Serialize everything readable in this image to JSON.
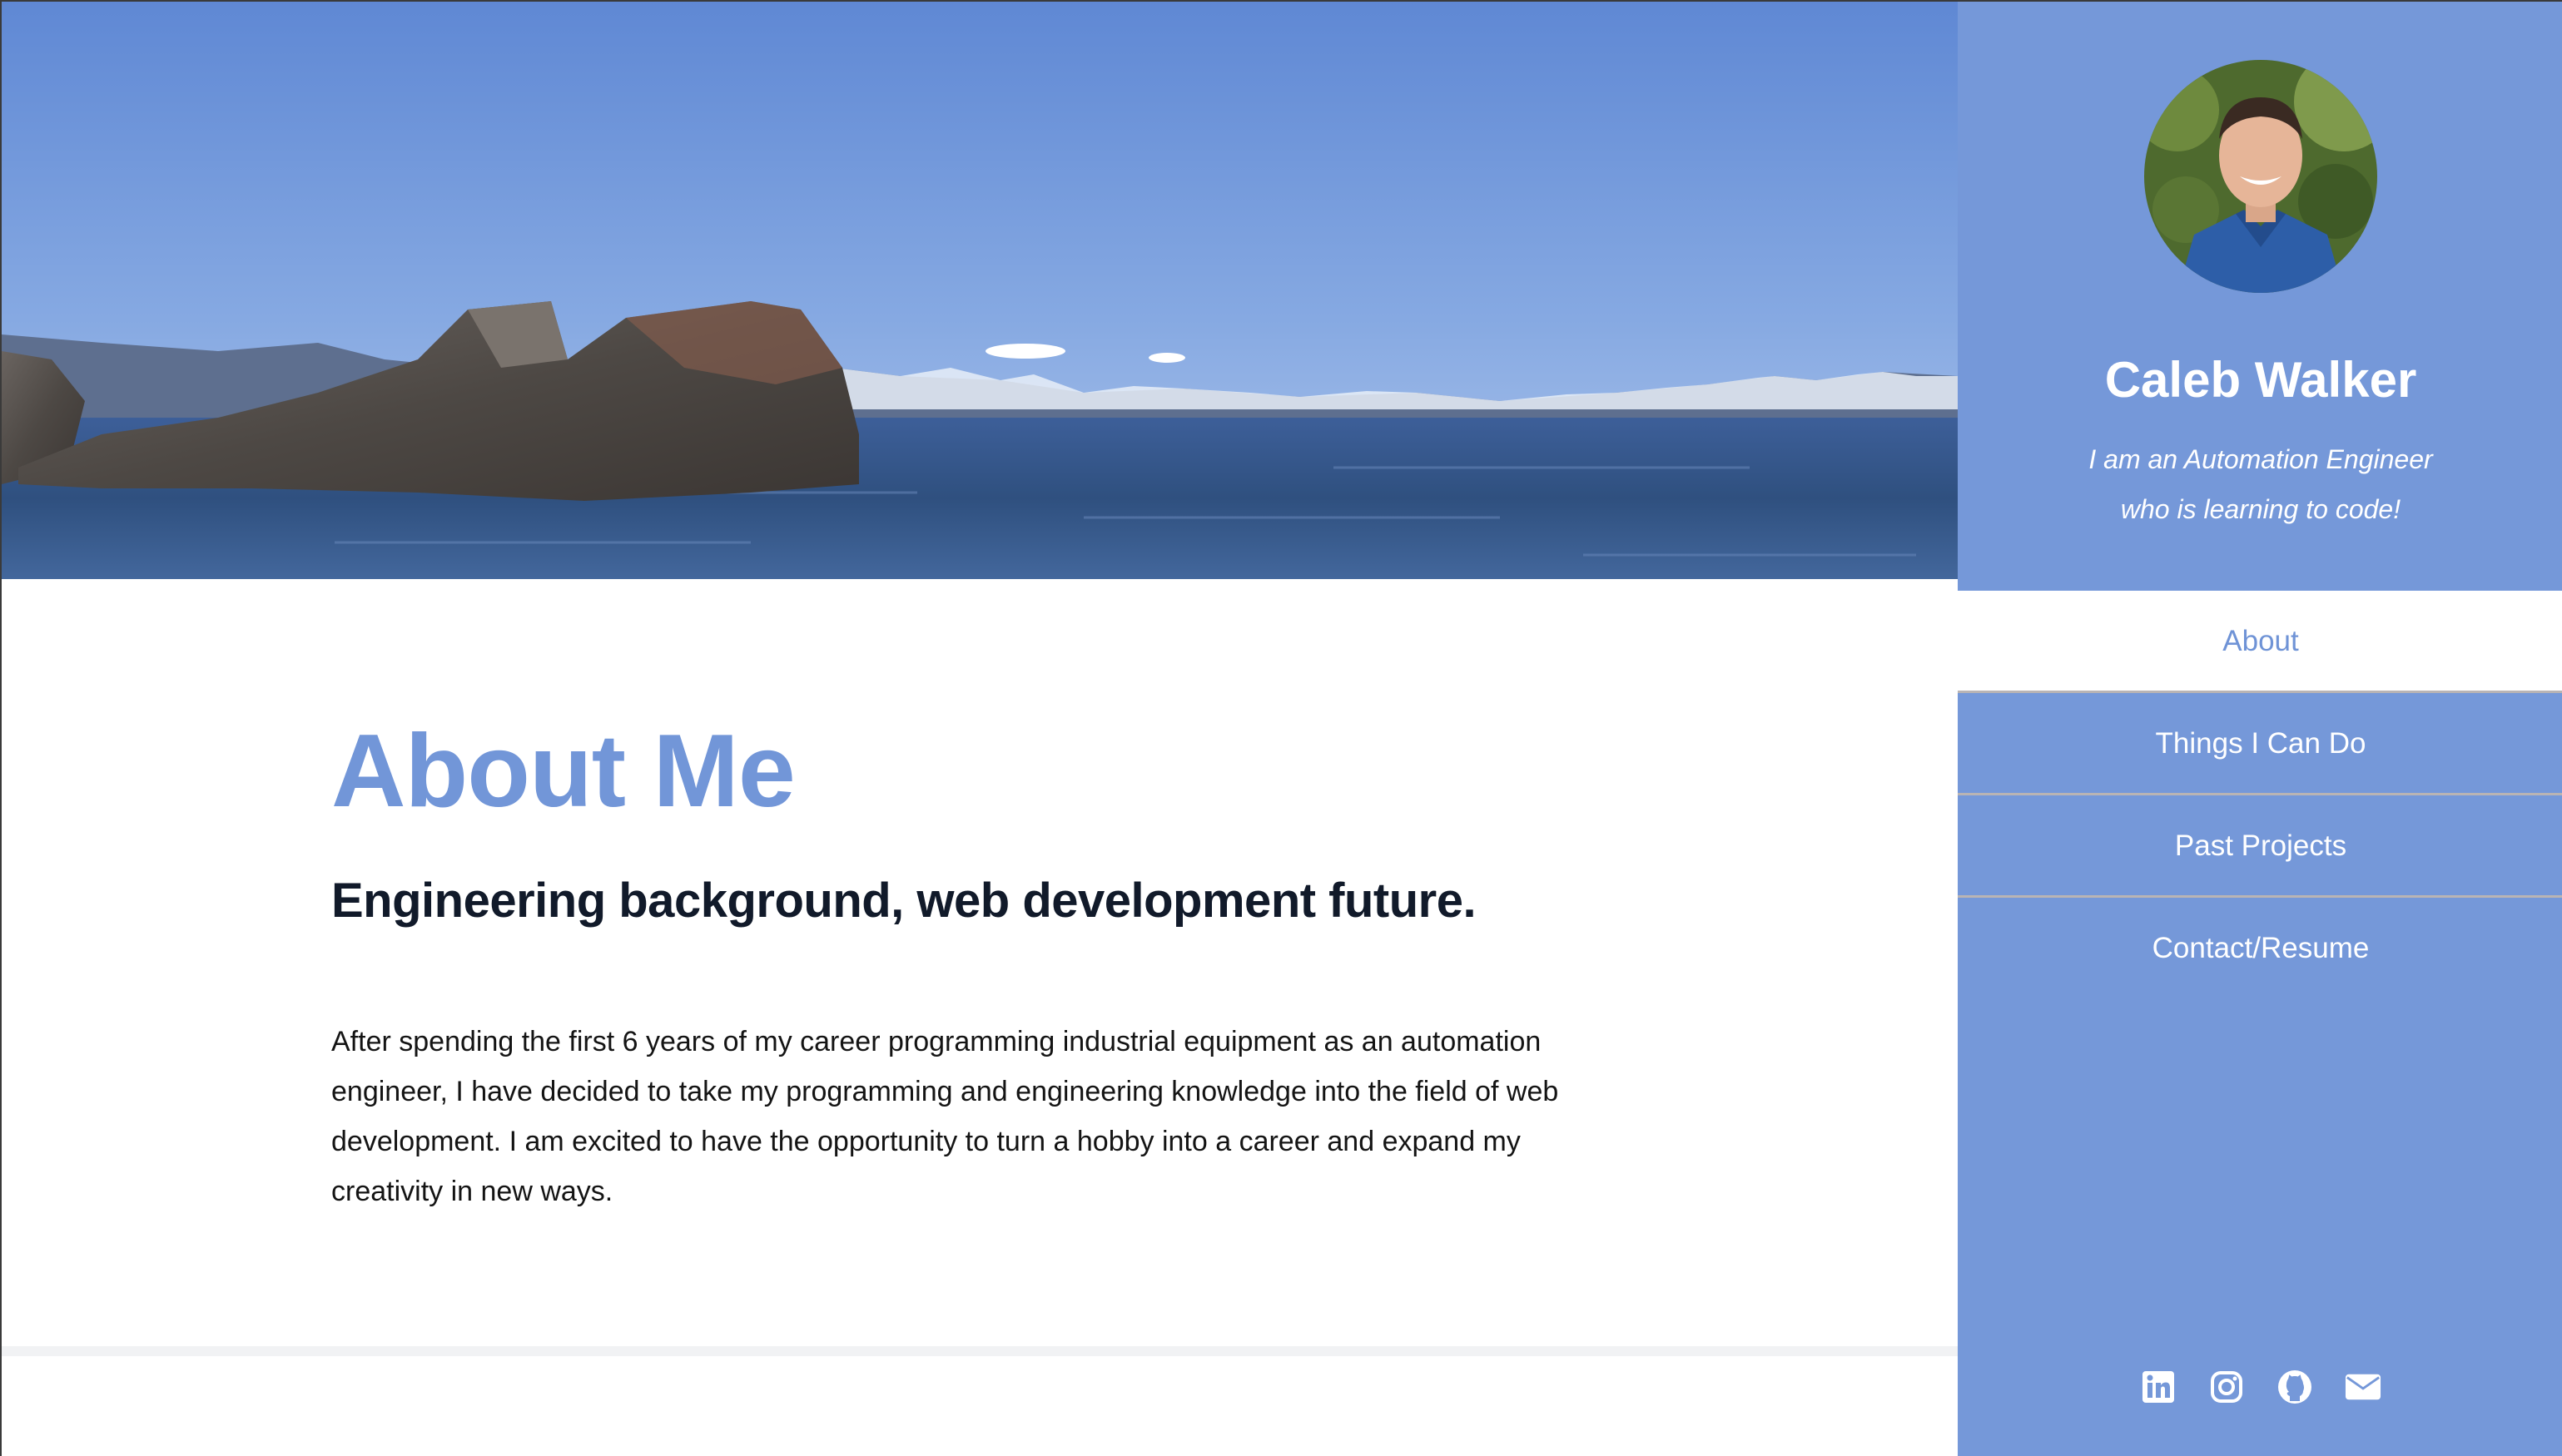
{
  "profile": {
    "name": "Caleb Walker",
    "tagline_line1": "I am an Automation Engineer",
    "tagline_line2": "who is learning to code!"
  },
  "nav": {
    "items": [
      {
        "label": "About",
        "active": true
      },
      {
        "label": "Things I Can Do",
        "active": false
      },
      {
        "label": "Past Projects",
        "active": false
      },
      {
        "label": "Contact/Resume",
        "active": false
      }
    ]
  },
  "about": {
    "heading": "About Me",
    "subheading": "Engineering background, web development future.",
    "body": "After spending the first 6 years of my career programming industrial equipment as an automation engineer, I have decided to take my programming and engineering knowledge into the field of web development. I am excited to have the opportunity to turn a hobby into a career and expand my creativity in new ways."
  },
  "socials": [
    {
      "icon": "linkedin-icon"
    },
    {
      "icon": "instagram-icon"
    },
    {
      "icon": "github-icon"
    },
    {
      "icon": "email-icon"
    }
  ],
  "colors": {
    "accent": "#7598d9",
    "heading": "#7296d8",
    "text": "#141414",
    "subheading": "#111a2a"
  }
}
